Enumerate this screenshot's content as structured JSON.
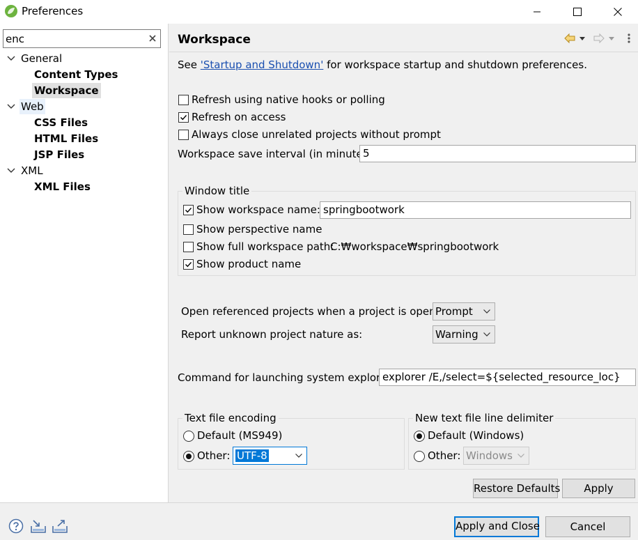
{
  "window": {
    "title": "Preferences"
  },
  "filter": {
    "value": "enc"
  },
  "tree": {
    "general": "General",
    "content_types": "Content Types",
    "workspace": "Workspace",
    "web": "Web",
    "css_files": "CSS Files",
    "html_files": "HTML Files",
    "jsp_files": "JSP Files",
    "xml": "XML",
    "xml_files": "XML Files"
  },
  "page": {
    "title": "Workspace",
    "see_prefix": "See ",
    "see_link": "'Startup and Shutdown'",
    "see_suffix": " for workspace startup and shutdown preferences."
  },
  "options": {
    "refresh_native": {
      "label": "Refresh using native hooks or polling",
      "checked": false
    },
    "refresh_access": {
      "label": "Refresh on access",
      "checked": true
    },
    "always_close": {
      "label": "Always close unrelated projects without prompt",
      "checked": false
    },
    "save_interval_label": "Workspace save interval (in minutes):",
    "save_interval_value": "5"
  },
  "window_title_group": {
    "title": "Window title",
    "show_workspace_name": {
      "label": "Show workspace name:",
      "checked": true,
      "value": "springbootwork"
    },
    "show_perspective_name": {
      "label": "Show perspective name",
      "checked": false
    },
    "show_full_path": {
      "label": "Show full workspace path:",
      "checked": false,
      "value": "C:₩workspace₩springbootwork"
    },
    "show_product_name": {
      "label": "Show product name",
      "checked": true
    }
  },
  "projects": {
    "open_referenced_label": "Open referenced projects when a project is opened:",
    "open_referenced_value": "Prompt",
    "unknown_nature_label": "Report unknown project nature as:",
    "unknown_nature_value": "Warning"
  },
  "explorer": {
    "label": "Command for launching system explorer:",
    "value": "explorer /E,/select=${selected_resource_loc}"
  },
  "encoding": {
    "title": "Text file encoding",
    "default_label": "Default (MS949)",
    "other_label": "Other:",
    "other_value": "UTF-8",
    "selected": "other"
  },
  "delimiter": {
    "title": "New text file line delimiter",
    "default_label": "Default (Windows)",
    "other_label": "Other:",
    "other_value": "Windows",
    "selected": "default"
  },
  "buttons": {
    "restore_defaults": "Restore Defaults",
    "apply": "Apply",
    "apply_and_close": "Apply and Close",
    "cancel": "Cancel"
  },
  "icons": {
    "app": "spring-leaf-icon",
    "help": "help-icon",
    "import": "import-icon",
    "export": "export-icon",
    "back": "back-arrow-icon",
    "forward": "forward-arrow-icon",
    "menu": "view-menu-icon"
  },
  "colors": {
    "accent": "#0078d7",
    "link": "#1a4fb0",
    "selection": "#0078d7"
  }
}
